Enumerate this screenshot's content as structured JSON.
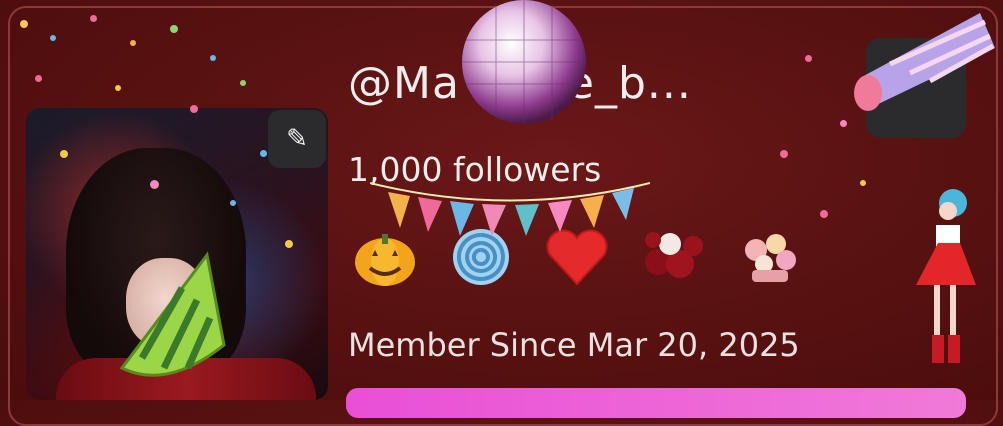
{
  "profile": {
    "username": "@Ma wave_b...",
    "followers": "1,000 followers",
    "member_since": "Member Since Mar 20, 2025"
  },
  "icons": {
    "edit": "pencil-icon",
    "badges": [
      "pumpkin-badge",
      "swirl-candy-badge",
      "heart-badge",
      "rose-bouquet-badge",
      "flower-bouquet-badge"
    ],
    "stickers": [
      "disco-ball",
      "party-horn",
      "party-hat",
      "bunting-banner",
      "dancing-girl",
      "confetti"
    ]
  },
  "colors": {
    "background": "#5a1212",
    "accent_pink": "#e94fd6",
    "button_dark": "#2b2b2e",
    "text": "#f2ecec"
  }
}
